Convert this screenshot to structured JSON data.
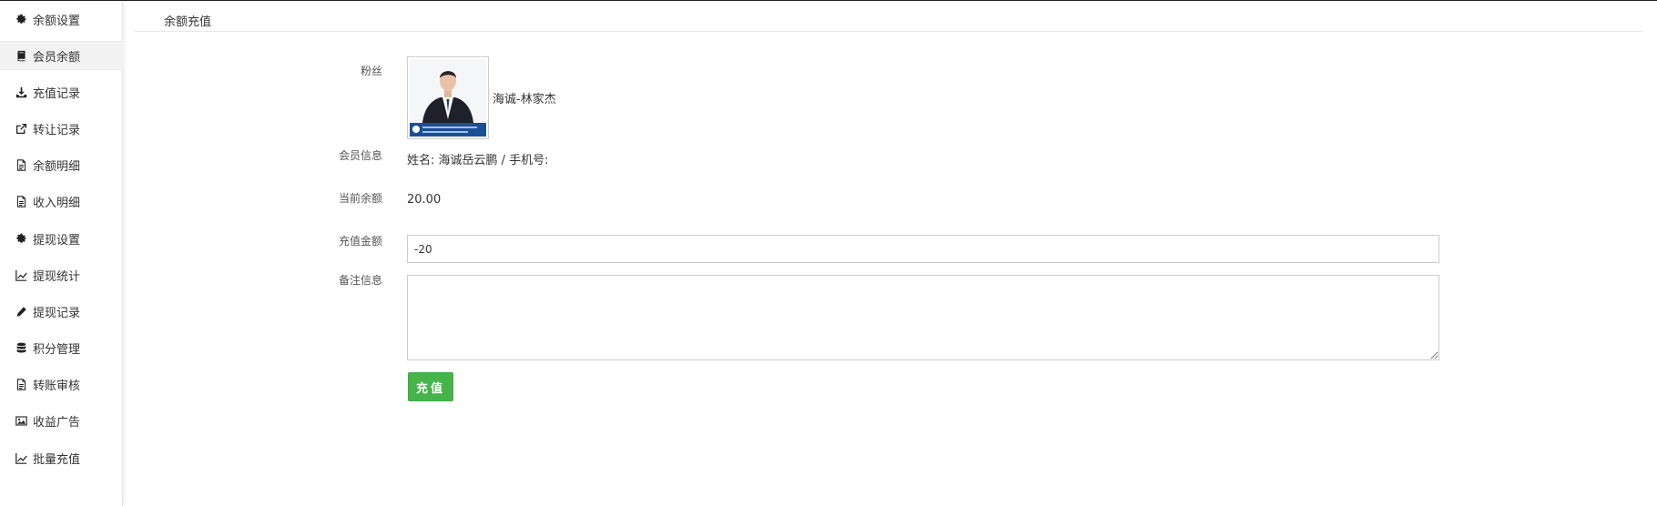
{
  "sidebar": {
    "items": [
      {
        "label": "余额设置",
        "icon": "gear-icon"
      },
      {
        "label": "会员余额",
        "icon": "book-icon",
        "active": true
      },
      {
        "label": "充值记录",
        "icon": "download-icon"
      },
      {
        "label": "转让记录",
        "icon": "external-link-icon"
      },
      {
        "label": "余额明细",
        "icon": "document-icon"
      },
      {
        "label": "收入明细",
        "icon": "document-icon"
      },
      {
        "label": "提现设置",
        "icon": "gear-icon"
      },
      {
        "label": "提现统计",
        "icon": "line-chart-icon"
      },
      {
        "label": "提现记录",
        "icon": "pencil-icon"
      },
      {
        "label": "积分管理",
        "icon": "database-icon"
      },
      {
        "label": "转账审核",
        "icon": "document-icon"
      },
      {
        "label": "收益广告",
        "icon": "image-icon"
      },
      {
        "label": "批量充值",
        "icon": "line-chart-icon"
      }
    ]
  },
  "header": {
    "title": "余额充值"
  },
  "form": {
    "fan_label": "粉丝",
    "fan_name": "海诚-林家杰",
    "member_info_label": "会员信息",
    "member_info_value": "姓名: 海诚岳云鹏 / 手机号:",
    "balance_label": "当前余额",
    "balance_value": "20.00",
    "amount_label": "充值金额",
    "amount_value": "-20",
    "remark_label": "备注信息",
    "remark_value": "",
    "submit_label": "充值"
  },
  "colors": {
    "accent": "#45b549",
    "active_bg": "#f2f2f2"
  }
}
